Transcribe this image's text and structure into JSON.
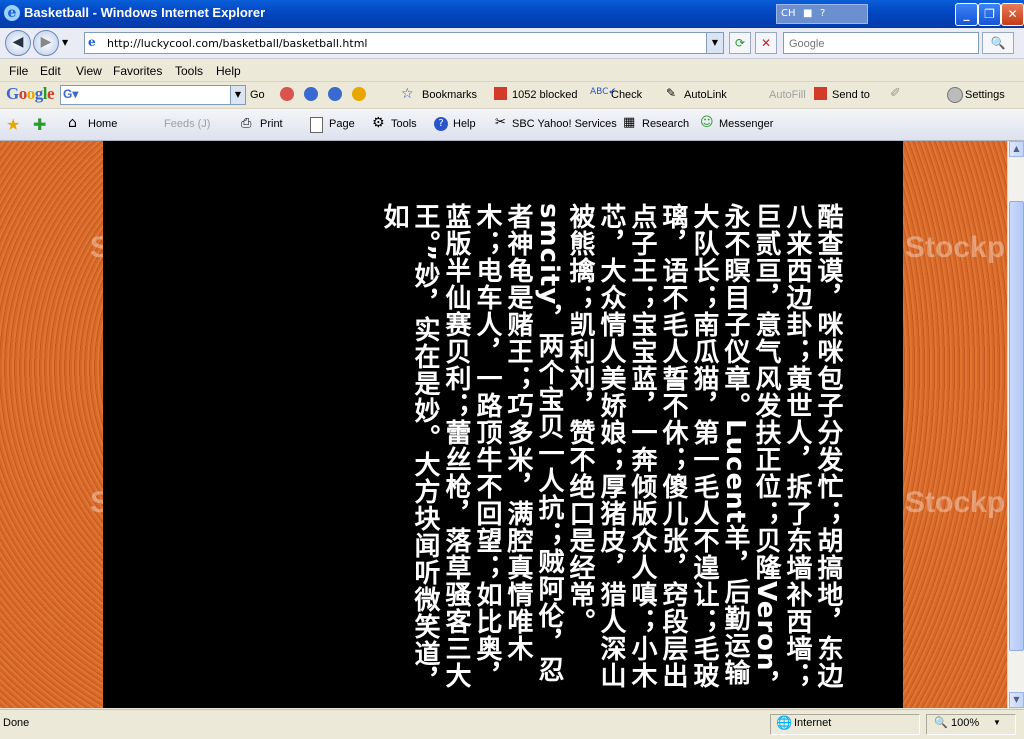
{
  "window": {
    "title": "Basketball - Windows Internet Explorer",
    "lang": "CH"
  },
  "address": {
    "url": "http://luckycool.com/basketball/basketball.html",
    "search_placeholder": "Google"
  },
  "menu": [
    "File",
    "Edit",
    "View",
    "Favorites",
    "Tools",
    "Help"
  ],
  "google_toolbar": {
    "logo": "Google",
    "go": "Go",
    "bookmarks": "Bookmarks",
    "blocked": "1052 blocked",
    "check": "Check",
    "autolink": "AutoLink",
    "autofill": "AutoFill",
    "send_to": "Send to",
    "settings": "Settings"
  },
  "command_bar": {
    "home": "Home",
    "feeds": "Feeds (J)",
    "print": "Print",
    "page": "Page",
    "tools": "Tools",
    "help": "Help",
    "sbc": "SBC Yahoo! Services",
    "research": "Research",
    "messenger": "Messenger"
  },
  "page": {
    "watermark": "Stockpho",
    "text": "酷查谟，咪咪包子分发忙；胡搞地，东边八来西边卦；黄世人，拆了东墙补西墙；巨贰亘，意气风发扶正位；贝隆Veron，永不瞑目子仪章。Lucent羊，后勤运输大队长；南瓜猫，第一毛人不遑让；毛玻璃，语不毛人誓不休；傻儿张，窍段层出点子王；宝宝蓝，一奔倾版众人嗔；小木芯，大众情人美娇娘；厚猪皮，猎人深山被熊擒；凯利刘，赞不绝口是经常。smcity，两个宝贝一人抗；贼阿伦，忍者神龟是赌王；巧多米，满腔真情唯木木；电车人，一路顶牛不回望；如比奥，蓝版半仙赛贝利；蕾丝枪，落草骚客三大王。”妙，实在是妙。大方块闻听微笑道，如"
  },
  "status": {
    "left": "Done",
    "zone": "Internet",
    "zoom": "100%"
  }
}
